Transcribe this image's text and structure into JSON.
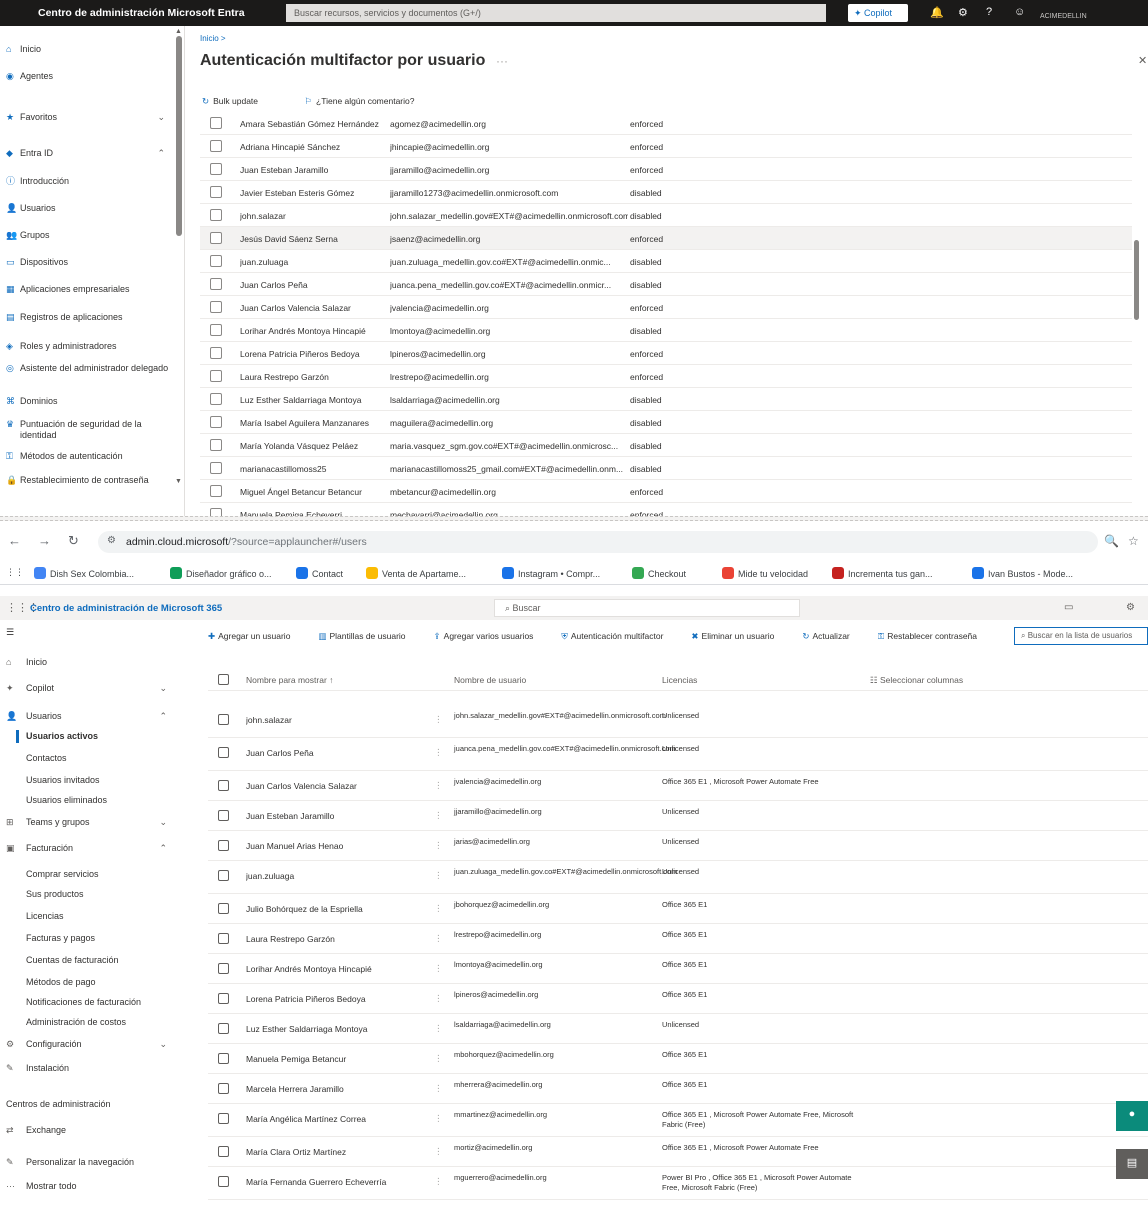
{
  "entra": {
    "brand": "Centro de administración Microsoft Entra",
    "search_placeholder": "Buscar recursos, servicios y documentos (G+/)",
    "copilot": "Copilot",
    "account": "ACIMEDELLIN",
    "sidebar": {
      "items": [
        {
          "label": "Inicio",
          "icon": "home-icon"
        },
        {
          "label": "Agentes",
          "icon": "agent-icon"
        },
        {
          "label": "Favoritos",
          "icon": "star-icon"
        },
        {
          "label": "Entra ID",
          "icon": "diamond-icon"
        },
        {
          "label": "Introducción",
          "icon": "info-icon"
        },
        {
          "label": "Usuarios",
          "icon": "user-icon"
        },
        {
          "label": "Grupos",
          "icon": "group-icon"
        },
        {
          "label": "Dispositivos",
          "icon": "device-icon"
        },
        {
          "label": "Aplicaciones empresariales",
          "icon": "apps-icon"
        },
        {
          "label": "Registros de aplicaciones",
          "icon": "register-icon"
        },
        {
          "label": "Roles y administradores",
          "icon": "roles-icon"
        },
        {
          "label": "Asistente del administrador delegado",
          "icon": "assistant-icon"
        },
        {
          "label": "Dominios",
          "icon": "domain-icon"
        },
        {
          "label": "Puntuación de seguridad de la identidad",
          "icon": "trophy-icon"
        },
        {
          "label": "Métodos de autenticación",
          "icon": "key-icon"
        },
        {
          "label": "Restablecimiento de contraseña",
          "icon": "lock-icon"
        }
      ]
    },
    "breadcrumb": "Inicio >",
    "title": "Autenticación multifactor por usuario",
    "toolbar": {
      "update": "Bulk update",
      "feedback": "¿Tiene algún comentario?"
    },
    "rows": [
      {
        "name": "Amara Sebastián Gómez Hernández",
        "user": "agomez@acimedellin.org",
        "status": "enforced",
        "selected": false
      },
      {
        "name": "Adriana Hincapié Sánchez",
        "user": "jhincapie@acimedellin.org",
        "status": "enforced",
        "selected": false
      },
      {
        "name": "Juan Esteban Jaramillo",
        "user": "jjaramillo@acimedellin.org",
        "status": "enforced",
        "selected": false
      },
      {
        "name": "Javier Esteban Esteris Gómez",
        "user": "jjaramillo1273@acimedellin.onmicrosoft.com",
        "status": "disabled",
        "selected": false
      },
      {
        "name": "john.salazar",
        "user": "john.salazar_medellin.gov#EXT#@acimedellin.onmicrosoft.com",
        "status": "disabled",
        "selected": false
      },
      {
        "name": "Jesús David Sáenz Serna",
        "user": "jsaenz@acimedellin.org",
        "status": "enforced",
        "selected": true
      },
      {
        "name": "juan.zuluaga",
        "user": "juan.zuluaga_medellin.gov.co#EXT#@acimedellin.onmic...",
        "status": "disabled",
        "selected": false
      },
      {
        "name": "Juan Carlos Peña",
        "user": "juanca.pena_medellin.gov.co#EXT#@acimedellin.onmicr...",
        "status": "disabled",
        "selected": false
      },
      {
        "name": "Juan Carlos Valencia Salazar",
        "user": "jvalencia@acimedellin.org",
        "status": "enforced",
        "selected": false
      },
      {
        "name": "Lorihar Andrés Montoya Hincapié",
        "user": "lmontoya@acimedellin.org",
        "status": "disabled",
        "selected": false
      },
      {
        "name": "Lorena Patricia Piñeros Bedoya",
        "user": "lpineros@acimedellin.org",
        "status": "enforced",
        "selected": false
      },
      {
        "name": "Laura Restrepo Garzón",
        "user": "lrestrepo@acimedellin.org",
        "status": "enforced",
        "selected": false
      },
      {
        "name": "Luz Esther Saldarriaga Montoya",
        "user": "lsaldarriaga@acimedellin.org",
        "status": "disabled",
        "selected": false
      },
      {
        "name": "María Isabel Aguilera Manzanares",
        "user": "maguilera@acimedellin.org",
        "status": "disabled",
        "selected": false
      },
      {
        "name": "María Yolanda Vásquez Peláez",
        "user": "maria.vasquez_sgm.gov.co#EXT#@acimedellin.onmicrosc...",
        "status": "disabled",
        "selected": false
      },
      {
        "name": "marianacastillomoss25",
        "user": "marianacastillomoss25_gmail.com#EXT#@acimedellin.onm...",
        "status": "disabled",
        "selected": false
      },
      {
        "name": "Miguel Ángel Betancur Betancur",
        "user": "mbetancur@acimedellin.org",
        "status": "enforced",
        "selected": false
      },
      {
        "name": "Manuela Pemiga Echeverri",
        "user": "mechavarri@acimedellin.org",
        "status": "enforced",
        "selected": false
      }
    ]
  },
  "browser": {
    "host": "admin.cloud.microsoft",
    "path": "/?source=applauncher#/users",
    "bookmarks": [
      {
        "label": "Dish Sex Colombia...",
        "color": "#4285f4"
      },
      {
        "label": "Diseñador gráfico o...",
        "color": "#0f9d58"
      },
      {
        "label": "Contact",
        "color": "#1a73e8"
      },
      {
        "label": "Venta de Apartame...",
        "color": "#fbbc04"
      },
      {
        "label": "Instagram • Compr...",
        "color": "#1a73e8"
      },
      {
        "label": "Checkout",
        "color": "#34a853"
      },
      {
        "label": "Mide tu velocidad",
        "color": "#ea4335"
      },
      {
        "label": "Incrementa tus gan...",
        "color": "#c5221f"
      },
      {
        "label": "Ivan Bustos - Mode...",
        "color": "#1a73e8"
      }
    ]
  },
  "m365": {
    "brand": "Centro de administración de Microsoft 365",
    "search_placeholder": "Buscar",
    "sidebar": {
      "items": [
        {
          "label": "Inicio",
          "icon": "home-icon",
          "type": "item"
        },
        {
          "label": "Copilot",
          "icon": "copilot-icon",
          "type": "item",
          "chev": true
        },
        {
          "label": "Usuarios",
          "icon": "user-icon",
          "type": "item",
          "chev": true
        },
        {
          "label": "Usuarios activos",
          "type": "sub",
          "active": true
        },
        {
          "label": "Contactos",
          "type": "sub"
        },
        {
          "label": "Usuarios invitados",
          "type": "sub"
        },
        {
          "label": "Usuarios eliminados",
          "type": "sub"
        },
        {
          "label": "Teams y grupos",
          "icon": "teams-icon",
          "type": "item",
          "chev": true
        },
        {
          "label": "Facturación",
          "icon": "billing-icon",
          "type": "item",
          "chev": true
        },
        {
          "label": "Comprar servicios",
          "type": "sub"
        },
        {
          "label": "Sus productos",
          "type": "sub"
        },
        {
          "label": "Licencias",
          "type": "sub"
        },
        {
          "label": "Facturas y pagos",
          "type": "sub"
        },
        {
          "label": "Cuentas de facturación",
          "type": "sub"
        },
        {
          "label": "Métodos de pago",
          "type": "sub"
        },
        {
          "label": "Notificaciones de facturación",
          "type": "sub"
        },
        {
          "label": "Administración de costos",
          "type": "sub"
        },
        {
          "label": "Configuración",
          "icon": "gear-icon",
          "type": "item",
          "chev": true
        },
        {
          "label": "Instalación",
          "icon": "setup-icon",
          "type": "item"
        },
        {
          "label": "Centros de administración",
          "type": "head"
        },
        {
          "label": "Exchange",
          "icon": "exchange-icon",
          "type": "item"
        },
        {
          "label": "Personalizar la navegación",
          "icon": "pencil-icon",
          "type": "item"
        },
        {
          "label": "Mostrar todo",
          "icon": "more-icon",
          "type": "item"
        }
      ]
    },
    "toolbar": [
      {
        "label": "Agregar un usuario",
        "icon": "add-user-icon"
      },
      {
        "label": "Plantillas de usuario",
        "icon": "template-icon"
      },
      {
        "label": "Agregar varios usuarios",
        "icon": "add-users-icon"
      },
      {
        "label": "Autenticación multifactor",
        "icon": "mfa-icon"
      },
      {
        "label": "Eliminar un usuario",
        "icon": "delete-user-icon"
      },
      {
        "label": "Actualizar",
        "icon": "refresh-icon"
      },
      {
        "label": "Restablecer contraseña",
        "icon": "key-icon"
      }
    ],
    "list_search_placeholder": "Buscar en la lista de usuarios",
    "columns": {
      "name": "Nombre para mostrar ↑",
      "user": "Nombre de usuario",
      "license": "Licencias",
      "choose": "Seleccionar columnas"
    },
    "rows": [
      {
        "name": "john.salazar",
        "user": "john.salazar_medellin.gov#EXT#@acimedellin.onmicrosoft.com",
        "license": "Unlicensed"
      },
      {
        "name": "Juan Carlos Peña",
        "user": "juanca.pena_medellin.gov.co#EXT#@acimedellin.onmicrosoft.com",
        "license": "Unlicensed"
      },
      {
        "name": "Juan Carlos Valencia Salazar",
        "user": "jvalencia@acimedellin.org",
        "license": "Office 365 E1 , Microsoft Power Automate Free"
      },
      {
        "name": "Juan Esteban Jaramillo",
        "user": "jjaramillo@acimedellin.org",
        "license": "Unlicensed"
      },
      {
        "name": "Juan Manuel Arias Henao",
        "user": "jarias@acimedellin.org",
        "license": "Unlicensed"
      },
      {
        "name": "juan.zuluaga",
        "user": "juan.zuluaga_medellin.gov.co#EXT#@acimedellin.onmicrosoft.com",
        "license": "Unlicensed"
      },
      {
        "name": "Julio Bohórquez de la Espriella",
        "user": "jbohorquez@acimedellin.org",
        "license": "Office 365 E1"
      },
      {
        "name": "Laura Restrepo Garzón",
        "user": "lrestrepo@acimedellin.org",
        "license": "Office 365 E1"
      },
      {
        "name": "Lorihar Andrés Montoya Hincapié",
        "user": "lmontoya@acimedellin.org",
        "license": "Office 365 E1"
      },
      {
        "name": "Lorena Patricia Piñeros Bedoya",
        "user": "lpineros@acimedellin.org",
        "license": "Office 365 E1"
      },
      {
        "name": "Luz Esther Saldarriaga Montoya",
        "user": "lsaldarriaga@acimedellin.org",
        "license": "Unlicensed"
      },
      {
        "name": "Manuela Pemiga Betancur",
        "user": "mbohorquez@acimedellin.org",
        "license": "Office 365 E1"
      },
      {
        "name": "Marcela Herrera Jaramillo",
        "user": "mherrera@acimedellin.org",
        "license": "Office 365 E1"
      },
      {
        "name": "María Angélica Martínez Correa",
        "user": "mmartinez@acimedellin.org",
        "license": "Office 365 E1 , Microsoft Power Automate Free, Microsoft Fabric (Free)"
      },
      {
        "name": "María Clara Ortiz Martínez",
        "user": "mortiz@acimedellin.org",
        "license": "Office 365 E1 , Microsoft Power Automate Free"
      },
      {
        "name": "María Fernanda Guerrero Echeverría",
        "user": "mguerrero@acimedellin.org",
        "license": "Power BI Pro , Office 365 E1 , Microsoft Power Automate Free, Microsoft Fabric (Free)"
      }
    ]
  }
}
